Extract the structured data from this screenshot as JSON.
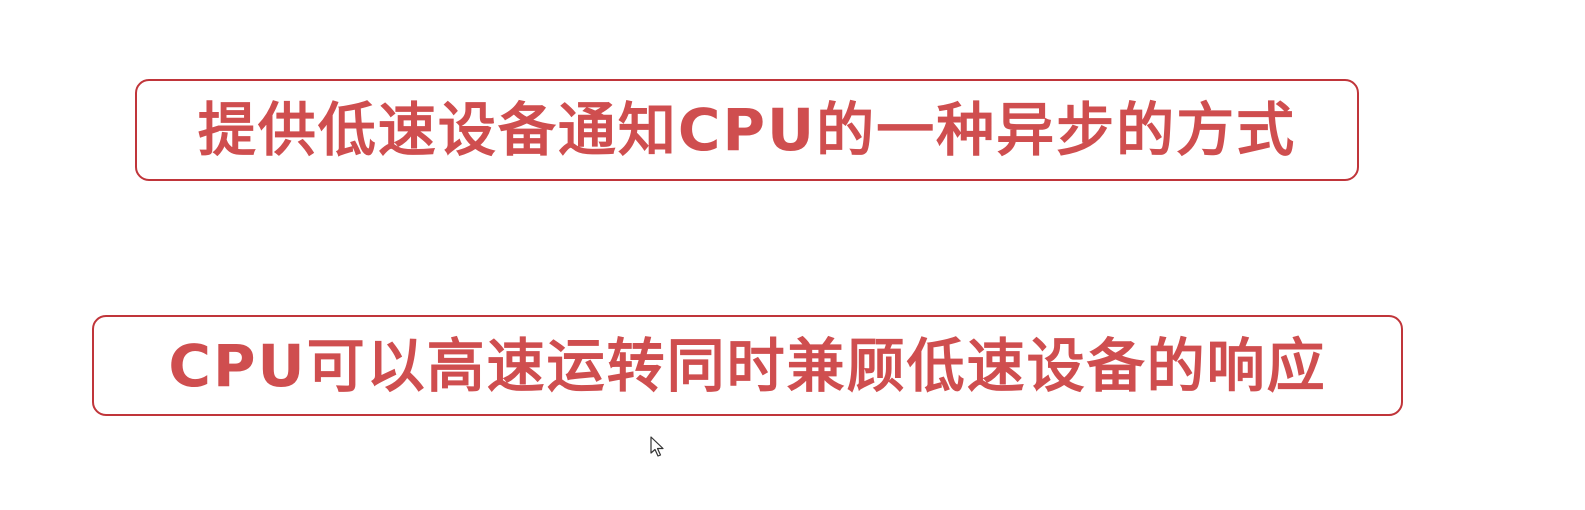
{
  "statements": [
    {
      "text": "提供低速设备通知CPU的一种异步的方式"
    },
    {
      "text": "CPU可以高速运转同时兼顾低速设备的响应"
    }
  ],
  "colors": {
    "border": "#c0353a",
    "text": "#cf4e4f",
    "background": "#ffffff"
  },
  "cursor": {
    "icon": "mouse-pointer-icon"
  }
}
